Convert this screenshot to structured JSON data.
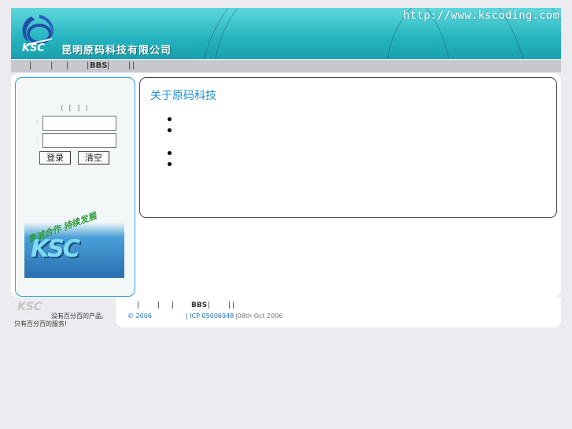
{
  "header": {
    "url_text": "http://www.kscoding.com",
    "logo_text": "KSC",
    "company_name": "昆明原码科技有限公司"
  },
  "nav": {
    "separators": [
      "|",
      "|",
      "|",
      "|",
      "|",
      "|"
    ],
    "bbs_label": "BBS"
  },
  "login": {
    "title": "(   [  ] )",
    "username_value": "",
    "password_value": "",
    "login_label": "登录",
    "clear_label": "清空"
  },
  "promo": {
    "slogan": "真诚合作 持续发展",
    "letters": "KSC"
  },
  "content": {
    "heading": "关于原码科技"
  },
  "footer": {
    "logo_text": "KSC",
    "slogan_line1": "没有百分百的产品,",
    "slogan_line2": "只有百分百的服务!",
    "nav_separators": [
      "|",
      "|",
      "|",
      "|",
      "|",
      "|"
    ],
    "bbs_label": "BBS",
    "copyright": "© 2006",
    "icp": "| ICP 05006948",
    "date": "|08th Oct 2006"
  },
  "colors": {
    "accent_blue": "#1d8fd2",
    "header_cyan": "#25b3bf",
    "panel_border": "#2aa4cf"
  }
}
